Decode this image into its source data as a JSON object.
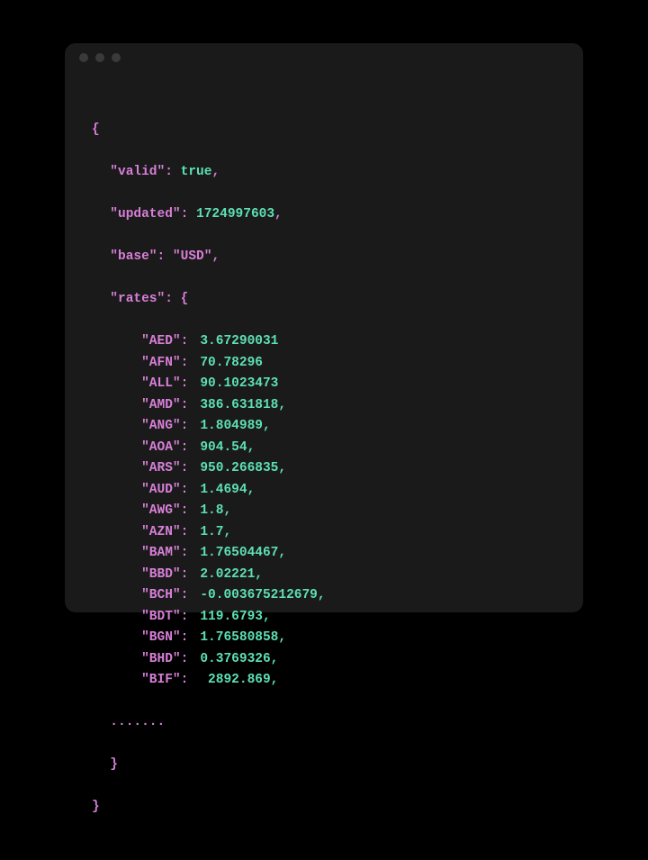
{
  "titlebar": {
    "dot1": "",
    "dot2": "",
    "dot3": ""
  },
  "json": {
    "open": "{",
    "valid_key": "\"valid\"",
    "valid_sep": ": ",
    "valid_val": "true",
    "valid_end": ",",
    "updated_key": "\"updated\"",
    "updated_sep": ": ",
    "updated_val": "1724997603",
    "updated_end": ",",
    "base_key": "\"base\"",
    "base_sep": ": ",
    "base_val": "\"USD\"",
    "base_end": ",",
    "rates_key": "\"rates\"",
    "rates_sep": ": {",
    "rates": [
      {
        "key": "\"AED\"",
        "sep": ":",
        "val": "3.67290031"
      },
      {
        "key": "\"AFN\"",
        "sep": ":",
        "val": "70.78296"
      },
      {
        "key": "\"ALL\"",
        "sep": ":",
        "val": "90.1023473"
      },
      {
        "key": "\"AMD\"",
        "sep": ":",
        "val": "386.631818,",
        "lead": ""
      },
      {
        "key": "\"ANG\"",
        "sep": ":",
        "val": "1.804989,",
        "lead": ""
      },
      {
        "key": "\"AOA\"",
        "sep": ":",
        "val": "904.54,",
        "lead": ""
      },
      {
        "key": "\"ARS\"",
        "sep": ":",
        "val": "950.266835,",
        "lead": ""
      },
      {
        "key": "\"AUD\"",
        "sep": ":",
        "val": "1.4694,",
        "lead": ""
      },
      {
        "key": "\"AWG\"",
        "sep": ":",
        "val": "1.8,",
        "lead": ""
      },
      {
        "key": "\"AZN\"",
        "sep": ":",
        "val": "1.7,",
        "lead": ""
      },
      {
        "key": "\"BAM\"",
        "sep": ":",
        "val": "1.76504467,",
        "lead": ""
      },
      {
        "key": "\"BBD\"",
        "sep": ":",
        "val": "2.02221,",
        "lead": ""
      },
      {
        "key": "\"BCH\"",
        "sep": ":",
        "val": "-0.003675212679,",
        "lead": ""
      },
      {
        "key": "\"BDT\"",
        "sep": ":",
        "val": "119.6793,",
        "lead": ""
      },
      {
        "key": "\"BGN\"",
        "sep": ":",
        "val": "1.76580858,",
        "lead": ""
      },
      {
        "key": "\"BHD\"",
        "sep": ":",
        "val": "0.3769326,",
        "lead": ""
      },
      {
        "key": "\"BIF\"",
        "sep": ":",
        "val": " 2892.869,",
        "lead": ""
      }
    ],
    "ellipsis": ".......",
    "rates_close": "}",
    "close": "}"
  }
}
